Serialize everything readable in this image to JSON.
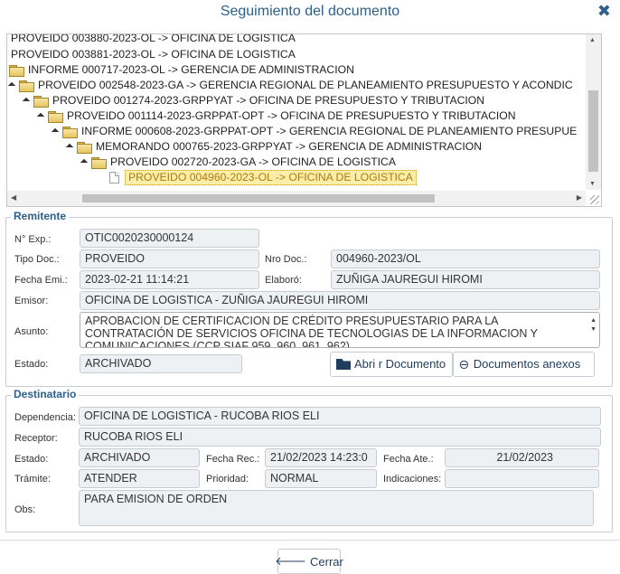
{
  "window": {
    "title": "Seguimiento del documento",
    "close_icon": "close-icon"
  },
  "tree": {
    "nodes": [
      "PROVEIDO 003880-2023-OL -> OFICINA DE LOGISTICA",
      "PROVEIDO 003881-2023-OL -> OFICINA DE LOGISTICA",
      "INFORME 000717-2023-OL -> GERENCIA DE ADMINISTRACION",
      "PROVEIDO 002548-2023-GA -> GERENCIA REGIONAL DE PLANEAMIENTO PRESUPUESTO Y ACONDIC",
      "PROVEIDO 001274-2023-GRPPYAT -> OFICINA DE PRESUPUESTO Y TRIBUTACION",
      "PROVEIDO 001114-2023-GRPPAT-OPT -> OFICINA DE PRESUPUESTO Y TRIBUTACION",
      "INFORME 000608-2023-GRPPAT-OPT -> GERENCIA REGIONAL DE PLANEAMIENTO PRESUPUE",
      "MEMORANDO 000765-2023-GRPPYAT -> GERENCIA DE ADMINISTRACION",
      "PROVEIDO 002720-2023-GA -> OFICINA DE LOGISTICA",
      "PROVEIDO 004960-2023-OL -> OFICINA DE LOGISTICA"
    ]
  },
  "remitente": {
    "legend": "Remitente",
    "nexp_label": "N° Exp.:",
    "nexp": "OTIC0020230000124",
    "tipodoc_label": "Tipo Doc.:",
    "tipodoc": "PROVEIDO",
    "nrodoc_label": "Nro Doc.:",
    "nrodoc": "004960-2023/OL",
    "fechaemi_label": "Fecha Emi.:",
    "fechaemi": "2023-02-21 11:14:21",
    "elaboro_label": "Elaboró:",
    "elaboro": "ZUÑIGA JAUREGUI HIROMI",
    "emisor_label": "Emisor:",
    "emisor": "OFICINA DE LOGISTICA - ZUÑIGA JAUREGUI HIROMI",
    "asunto_label": "Asunto:",
    "asunto": "APROBACION DE CERTIFICACION DE CRÉDITO PRESUPUESTARIO PARA LA CONTRATACIÓN DE SERVICIOS OFICINA DE TECNOLOGIAS DE LA INFORMACION Y COMUNICACIONES  (CCP SIAF 959, 960, 961, 962)",
    "estado_label": "Estado:",
    "estado": "ARCHIVADO",
    "abrir_button": "Abri r Documento",
    "anexos_button": "Documentos anexos"
  },
  "destinatario": {
    "legend": "Destinatario",
    "dependencia_label": "Dependencia:",
    "dependencia": "OFICINA DE LOGISTICA - RUCOBA RIOS ELI",
    "receptor_label": "Receptor:",
    "receptor": "RUCOBA RIOS ELI",
    "estado_label": "Estado:",
    "estado": "ARCHIVADO",
    "fecharec_label": "Fecha Rec.:",
    "fecharec": "21/02/2023 14:23:0",
    "fechaate_label": "Fecha Ate.:",
    "fechaate": "21/02/2023",
    "tramite_label": "Trámite:",
    "tramite": "ATENDER",
    "prioridad_label": "Prioridad:",
    "prioridad": "NORMAL",
    "indicaciones_label": "Indicaciones:",
    "indicaciones": "",
    "obs_label": "Obs:",
    "obs": "PARA EMISION DE ORDEN"
  },
  "footer": {
    "cerrar_button": "Cerrar"
  }
}
